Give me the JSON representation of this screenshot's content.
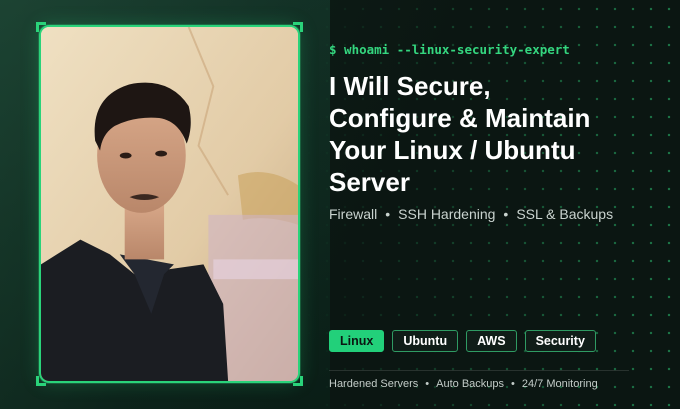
{
  "terminal_prompt": "$ whoami --linux-security-expert",
  "headline": {
    "line1": "I Will Secure,",
    "line2": "Configure & Maintain",
    "line3": "Your Linux / Ubuntu",
    "line4": "Server"
  },
  "services": [
    "Firewall",
    "SSH Hardening",
    "SSL & Backups"
  ],
  "tags": [
    "Linux",
    "Ubuntu",
    "AWS",
    "Security"
  ],
  "footer": [
    "Hardened Servers",
    "Auto Backups",
    "24/7 Monitoring"
  ],
  "separator": "•",
  "colors": {
    "accent": "#22d07a",
    "background": "#0b1612"
  },
  "photo_icon": "portrait-photo"
}
